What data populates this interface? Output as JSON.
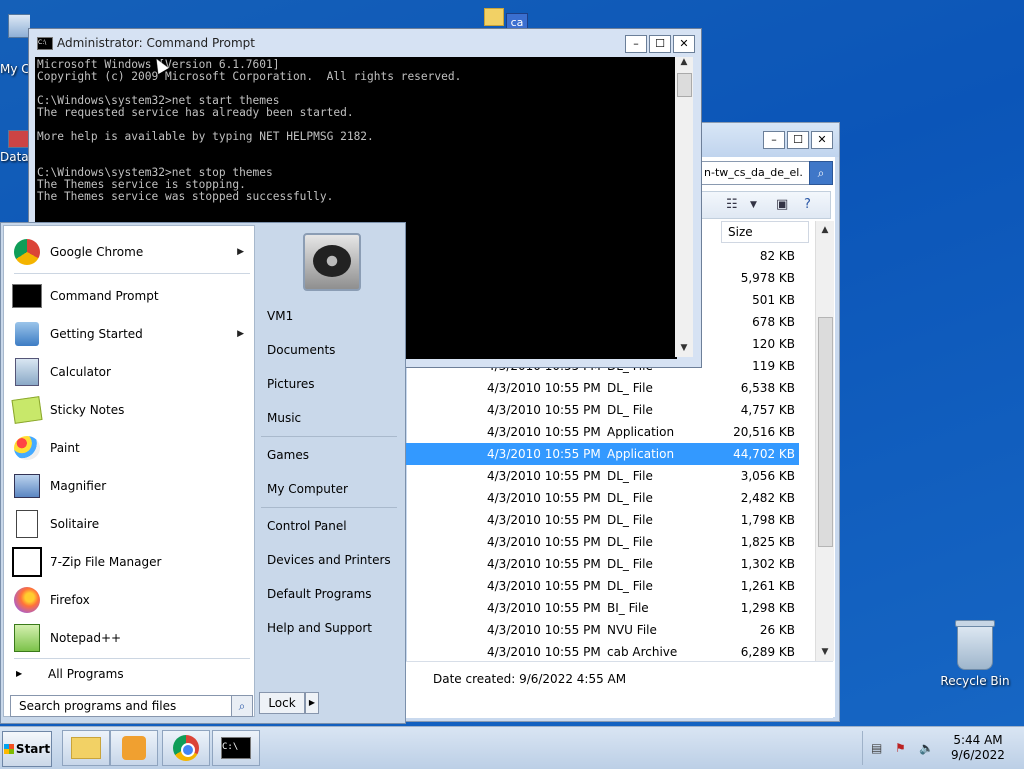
{
  "desktop": {
    "recycle_bin_label": "Recycle Bin",
    "partial_labels": [
      "My C",
      "Data"
    ],
    "folder_badge": "ca"
  },
  "cmd": {
    "title": "Administrator: Command Prompt",
    "console_text": "Microsoft Windows [Version 6.1.7601]\nCopyright (c) 2009 Microsoft Corporation.  All rights reserved.\n\nC:\\Windows\\system32>net start themes\nThe requested service has already been started.\n\nMore help is available by typing NET HELPMSG 2182.\n\n\nC:\\Windows\\system32>net stop themes\nThe Themes service is stopping.\nThe Themes service was stopped successfully.",
    "icon_text": "C:\\"
  },
  "explorer": {
    "address_text": "n-tw_cs_da_de_el.",
    "column_size": "Size",
    "partial_sizes": [
      "82 KB",
      "5,978 KB",
      "501 KB",
      "678 KB",
      "120 KB"
    ],
    "rows": [
      {
        "date": "4/3/2010 10:55 PM",
        "type": "DL_ File",
        "size": "119 KB"
      },
      {
        "date": "4/3/2010 10:55 PM",
        "type": "DL_ File",
        "size": "6,538 KB"
      },
      {
        "date": "4/3/2010 10:55 PM",
        "type": "DL_ File",
        "size": "4,757 KB"
      },
      {
        "date": "4/3/2010 10:55 PM",
        "type": "Application",
        "size": "20,516 KB"
      },
      {
        "date": "4/3/2010 10:55 PM",
        "type": "Application",
        "size": "44,702 KB",
        "selected": true
      },
      {
        "date": "4/3/2010 10:55 PM",
        "type": "DL_ File",
        "size": "3,056 KB"
      },
      {
        "date": "4/3/2010 10:55 PM",
        "type": "DL_ File",
        "size": "2,482 KB"
      },
      {
        "date": "4/3/2010 10:55 PM",
        "type": "DL_ File",
        "size": "1,798 KB"
      },
      {
        "date": "4/3/2010 10:55 PM",
        "type": "DL_ File",
        "size": "1,825 KB"
      },
      {
        "date": "4/3/2010 10:55 PM",
        "type": "DL_ File",
        "size": "1,302 KB"
      },
      {
        "date": "4/3/2010 10:55 PM",
        "type": "DL_ File",
        "size": "1,261 KB"
      },
      {
        "date": "4/3/2010 10:55 PM",
        "type": "BI_ File",
        "size": "1,298 KB"
      },
      {
        "date": "4/3/2010 10:55 PM",
        "type": "NVU File",
        "size": "26 KB"
      },
      {
        "date": "4/3/2010 10:55 PM",
        "type": "cab Archive",
        "size": "6,289 KB"
      }
    ],
    "details_date_created": "Date created: 9/6/2022 4:55 AM"
  },
  "startmenu": {
    "pinned": [
      {
        "label": "Google Chrome",
        "icon": "chrome-icon",
        "submenu": true
      },
      {
        "label": "Command Prompt",
        "icon": "cmd-icon"
      },
      {
        "label": "Getting Started",
        "icon": "getting-started-icon",
        "submenu": true
      },
      {
        "label": "Calculator",
        "icon": "calculator-icon"
      },
      {
        "label": "Sticky Notes",
        "icon": "sticky-notes-icon"
      },
      {
        "label": "Paint",
        "icon": "paint-icon"
      },
      {
        "label": "Magnifier",
        "icon": "magnifier-icon"
      },
      {
        "label": "Solitaire",
        "icon": "solitaire-icon"
      },
      {
        "label": "7-Zip File Manager",
        "icon": "7zip-icon"
      },
      {
        "label": "Firefox",
        "icon": "firefox-icon"
      },
      {
        "label": "Notepad++",
        "icon": "notepadpp-icon"
      }
    ],
    "all_programs": "All Programs",
    "search_placeholder": "Search programs and files",
    "right": [
      "VM1",
      "Documents",
      "Pictures",
      "Music",
      "Games",
      "My Computer",
      "Control Panel",
      "Devices and Printers",
      "Default Programs",
      "Help and Support"
    ],
    "lock_label": "Lock"
  },
  "taskbar": {
    "start_label": "Start",
    "time": "5:44 AM",
    "date": "9/6/2022"
  }
}
